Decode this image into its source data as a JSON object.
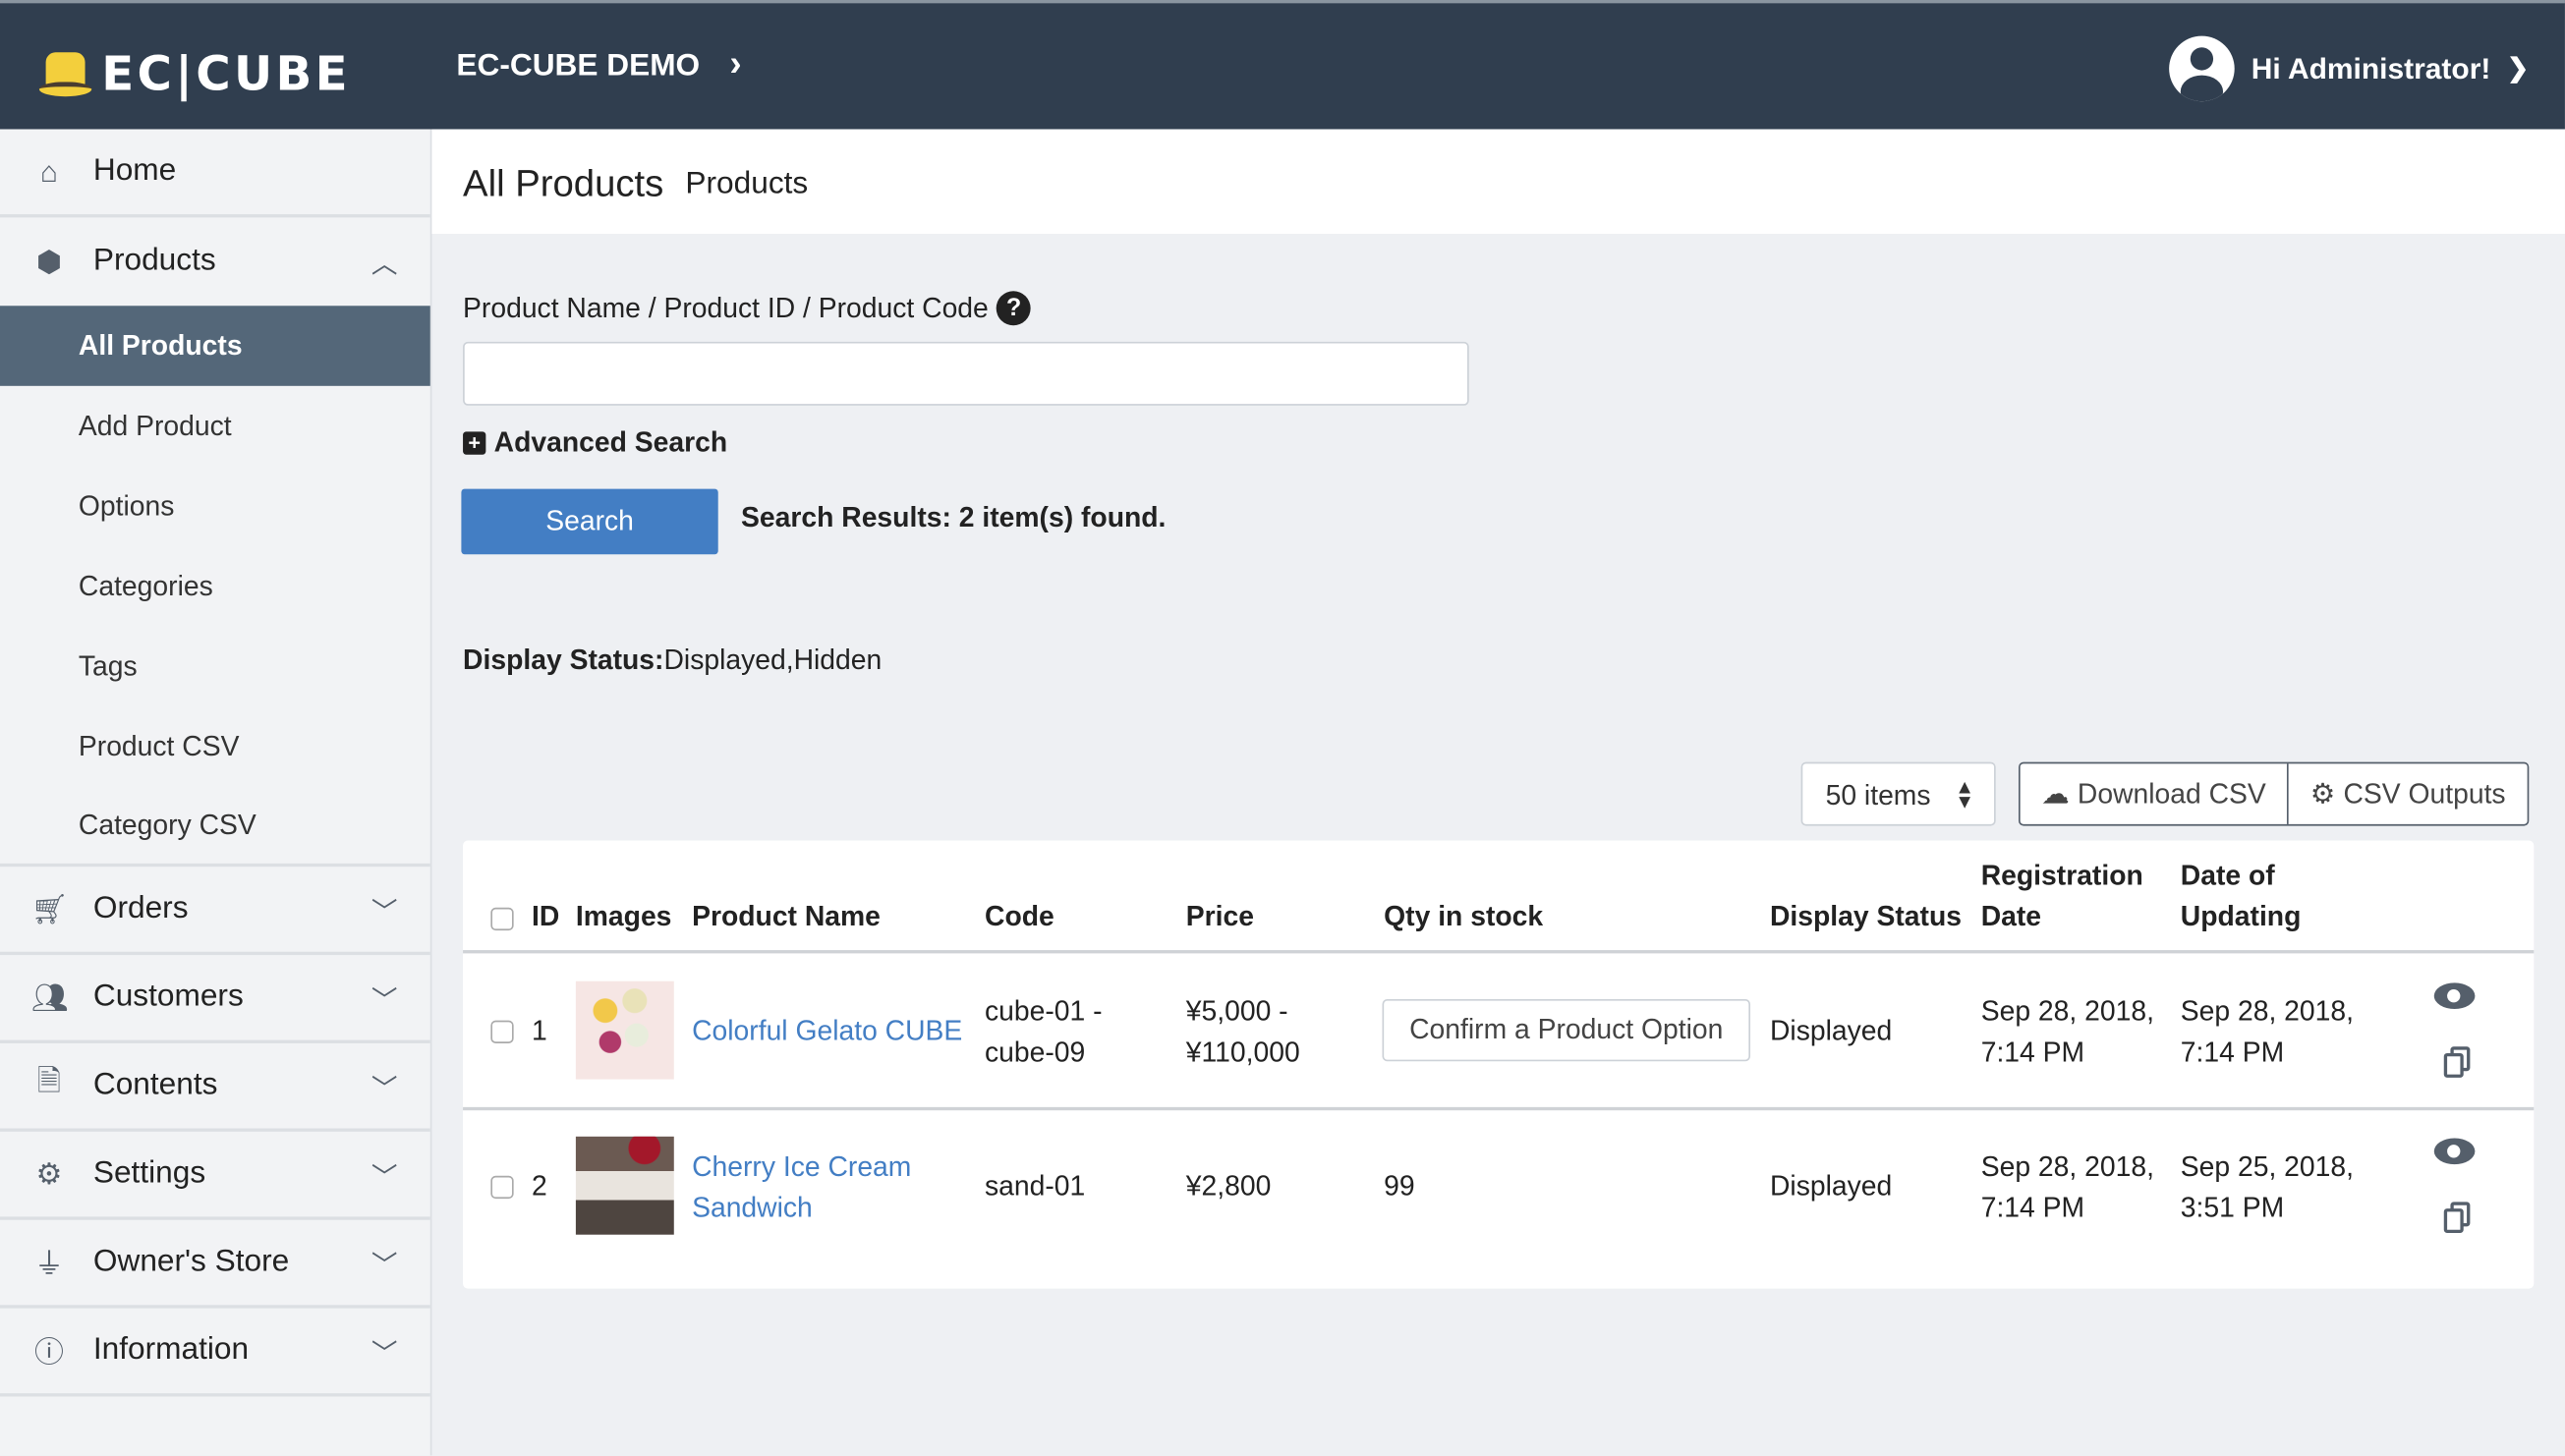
{
  "header": {
    "logo_text": "EC|CUBE",
    "shop_name": "EC-CUBE DEMO",
    "greeting": "Hi Administrator!",
    "colors": {
      "header_bg": "#303e4f",
      "accent": "#437ec4",
      "logo_yellow": "#f3cf3c"
    }
  },
  "sidebar": {
    "home": {
      "label": "Home",
      "icon": "home-icon"
    },
    "products": {
      "label": "Products",
      "icon": "box-icon",
      "expanded": true,
      "items": [
        {
          "label": "All Products",
          "active": true
        },
        {
          "label": "Add Product"
        },
        {
          "label": "Options"
        },
        {
          "label": "Categories"
        },
        {
          "label": "Tags"
        },
        {
          "label": "Product CSV"
        },
        {
          "label": "Category CSV"
        }
      ]
    },
    "others": [
      {
        "label": "Orders",
        "icon": "cart-icon"
      },
      {
        "label": "Customers",
        "icon": "users-icon"
      },
      {
        "label": "Contents",
        "icon": "file-icon"
      },
      {
        "label": "Settings",
        "icon": "gear-icon"
      },
      {
        "label": "Owner's Store",
        "icon": "plug-icon"
      },
      {
        "label": "Information",
        "icon": "info-icon"
      }
    ]
  },
  "page": {
    "title": "All Products",
    "subtitle": "Products"
  },
  "search": {
    "label": "Product Name / Product ID / Product Code",
    "value": "",
    "help": "?",
    "advanced": "Advanced Search",
    "button": "Search",
    "results": "Search Results: 2 item(s) found.",
    "status_label": "Display Status:",
    "status_value": "Displayed,Hidden"
  },
  "toolbar": {
    "per_page": "50 items",
    "download_csv": "Download CSV",
    "csv_outputs": "CSV Outputs"
  },
  "table": {
    "headers": {
      "id": "ID",
      "images": "Images",
      "name": "Product Name",
      "code": "Code",
      "price": "Price",
      "qty": "Qty in stock",
      "status": "Display Status",
      "reg1": "Registration",
      "reg2": "Date",
      "upd1": "Date of",
      "upd2": "Updating"
    },
    "rows": [
      {
        "id": "1",
        "name": "Colorful Gelato CUBE",
        "code1": "cube-01 -",
        "code2": "cube-09",
        "price1": "¥5,000 -",
        "price2": "¥110,000",
        "qty": "Confirm a Product Option",
        "status": "Displayed",
        "reg1": "Sep 28, 2018,",
        "reg2": "7:14 PM",
        "upd1": "Sep 28, 2018,",
        "upd2": "7:14 PM"
      },
      {
        "id": "2",
        "name1": "Cherry Ice Cream",
        "name2": "Sandwich",
        "code1": "sand-01",
        "price1": "¥2,800",
        "qty": "99",
        "status": "Displayed",
        "reg1": "Sep 28, 2018,",
        "reg2": "7:14 PM",
        "upd1": "Sep 25, 2018,",
        "upd2": "3:51 PM"
      }
    ]
  }
}
